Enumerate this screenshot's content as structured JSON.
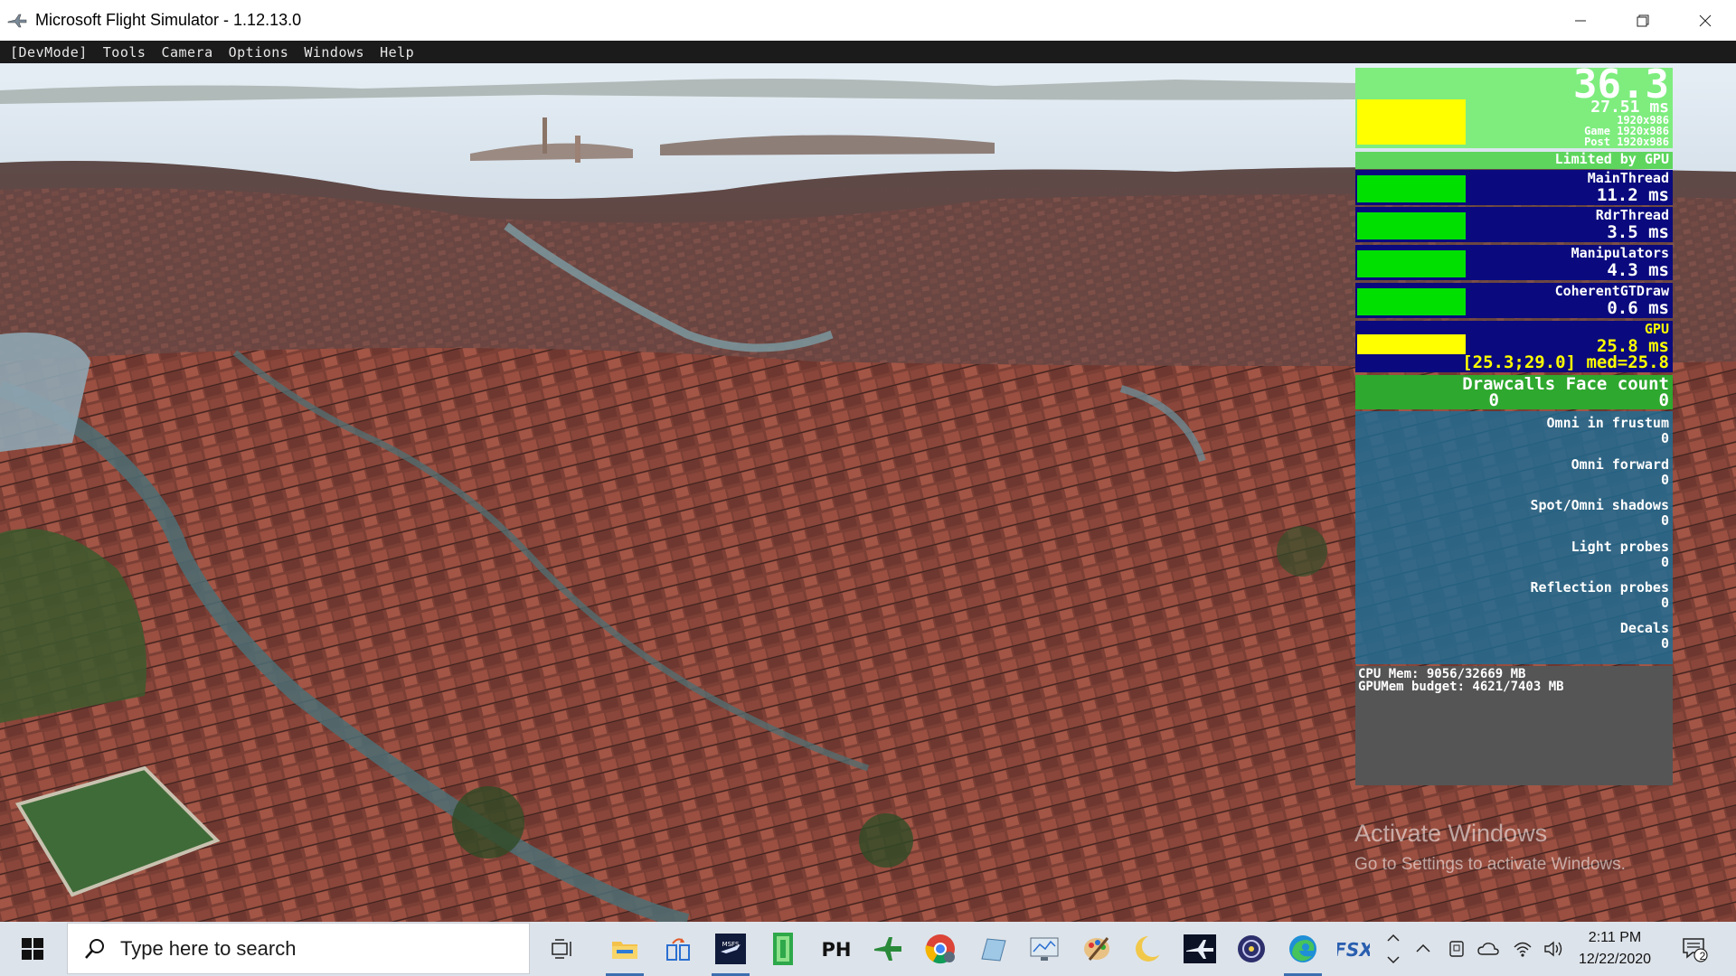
{
  "window": {
    "title": "Microsoft Flight Simulator - 1.12.13.0"
  },
  "menu": [
    "[DevMode]",
    "Tools",
    "Camera",
    "Options",
    "Windows",
    "Help"
  ],
  "perf": {
    "fps": "36.3",
    "frame_ms": "27.51 ms",
    "res_lines": [
      "1920x986",
      "Game 1920x986",
      "Post 1920x986"
    ],
    "limited_by": "Limited by GPU",
    "threads": [
      {
        "name": "MainThread",
        "value": "11.2 ms"
      },
      {
        "name": "RdrThread",
        "value": "3.5 ms"
      },
      {
        "name": "Manipulators",
        "value": "4.3 ms"
      },
      {
        "name": "CoherentGTDraw",
        "value": "0.6 ms"
      }
    ],
    "gpu": {
      "name": "GPU",
      "value": "25.8 ms",
      "range": "[25.3;29.0] med=25.8"
    },
    "drawcalls_header": "Drawcalls Face count",
    "drawcalls_value": "0",
    "facecount_value": "0",
    "stats": [
      {
        "label": "Omni in frustum",
        "value": "0"
      },
      {
        "label": "Omni forward",
        "value": "0"
      },
      {
        "label": "Spot/Omni shadows",
        "value": "0"
      },
      {
        "label": "Light probes",
        "value": "0"
      },
      {
        "label": "Reflection probes",
        "value": "0"
      },
      {
        "label": "Decals",
        "value": "0"
      }
    ],
    "mem_lines": [
      "CPU Mem: 9056/32669 MB",
      "GPUMem budget: 4621/7403 MB"
    ]
  },
  "watermark": {
    "line1": "Activate Windows",
    "line2": "Go to Settings to activate Windows."
  },
  "taskbar": {
    "search_placeholder": "Type here to search",
    "time": "2:11 PM",
    "date": "12/22/2020",
    "notification_count": "2",
    "pinned": [
      "task-view-icon",
      "file-explorer-icon",
      "share-icon",
      "app-icon",
      "excel-like-icon",
      "ph-icon",
      "plane-icon",
      "chrome-icon",
      "folder-icon",
      "monitor-icon",
      "paint-icon",
      "crescent-icon",
      "jet-icon",
      "circle-app-icon",
      "edge-icon",
      "fsx-icon"
    ]
  },
  "colors": {
    "panel_blue": "#0a0a7e",
    "panel_green": "#3bd13b",
    "bar_green": "#00e000",
    "bar_yellow": "#ffff00",
    "taskbar": "#dde3ea"
  }
}
